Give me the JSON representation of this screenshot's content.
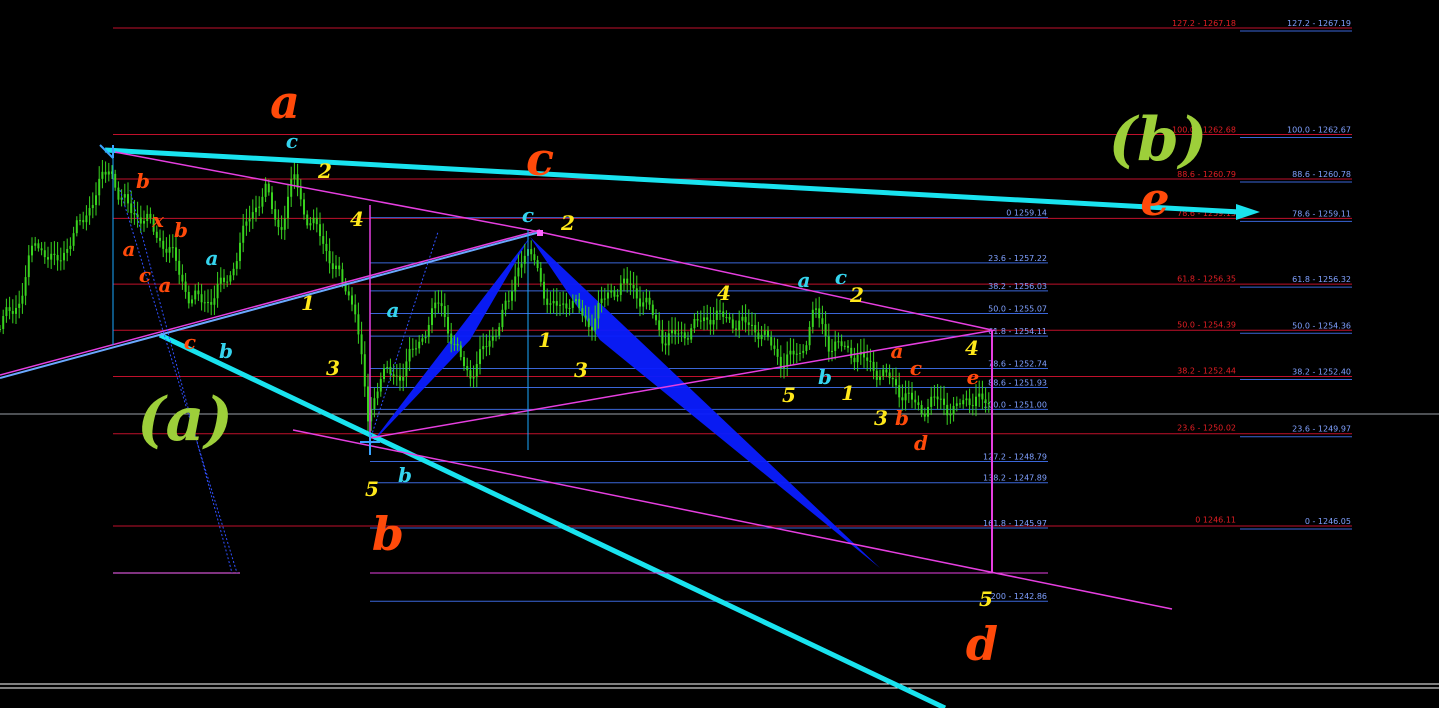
{
  "chart_data": {
    "type": "candlestick",
    "title": "",
    "colors": {
      "background": "#000000",
      "candle": "#39d31f",
      "fib_red_line": "#c0102b",
      "fib_red_text": "#e31e24",
      "fib_blue_line": "#3a66d8",
      "fib_blue_text": "#7fa0ff",
      "trend_cyan": "#19e3ef",
      "channel_magenta": "#e63fe0",
      "pattern_blue": "#0a1cff",
      "wave_orange": "#ff4a0a",
      "wave_yellow": "#ffe81a",
      "wave_cyan": "#35d4ee",
      "wave_green": "#9dcf3a"
    },
    "fib_set_right": [
      {
        "ratio": "127.2",
        "value": 1267.19
      },
      {
        "ratio": "100.0",
        "value": 1262.67
      },
      {
        "ratio": "88.6",
        "value": 1260.78
      },
      {
        "ratio": "78.6",
        "value": 1259.11
      },
      {
        "ratio": "61.8",
        "value": 1256.32
      },
      {
        "ratio": "50.0",
        "value": 1254.36
      },
      {
        "ratio": "38.2",
        "value": 1252.4
      },
      {
        "ratio": "23.6",
        "value": 1249.97
      },
      {
        "ratio": "0",
        "value": 1246.05
      }
    ],
    "fib_set_middle": [
      {
        "ratio": "127.2",
        "value": 1267.18
      },
      {
        "ratio": "100.0",
        "value": 1262.68
      },
      {
        "ratio": "88.6",
        "value": 1260.79
      },
      {
        "ratio": "78.6",
        "value": 1259.13
      },
      {
        "ratio": "61.8",
        "value": 1256.35
      },
      {
        "ratio": "50.0",
        "value": 1254.39
      },
      {
        "ratio": "38.2",
        "value": 1252.44
      },
      {
        "ratio": "23.6",
        "value": 1250.02
      },
      {
        "ratio": "0",
        "value": 1246.11
      }
    ],
    "fib_set_left": [
      {
        "ratio": "0",
        "value": 1259.14
      },
      {
        "ratio": "23.6",
        "value": 1257.22
      },
      {
        "ratio": "38.2",
        "value": 1256.03
      },
      {
        "ratio": "50.0",
        "value": 1255.07
      },
      {
        "ratio": "61.8",
        "value": 1254.11
      },
      {
        "ratio": "78.6",
        "value": 1252.74
      },
      {
        "ratio": "88.6",
        "value": 1251.93
      },
      {
        "ratio": "100.0",
        "value": 1251.0
      },
      {
        "ratio": "127.2",
        "value": 1248.79
      },
      {
        "ratio": "138.2",
        "value": 1247.89
      },
      {
        "ratio": "161.8",
        "value": 1245.97
      },
      {
        "ratio": "200",
        "value": 1242.86
      }
    ],
    "wave_labels": [
      {
        "text": "a",
        "color": "orange",
        "size": "large"
      },
      {
        "text": "c",
        "color": "orange",
        "size": "large"
      },
      {
        "text": "b",
        "color": "orange",
        "size": "large"
      },
      {
        "text": "d",
        "color": "orange",
        "size": "large"
      },
      {
        "text": "e",
        "color": "orange",
        "size": "large"
      },
      {
        "text": "(a)",
        "color": "green",
        "size": "xlarge"
      },
      {
        "text": "(b)",
        "color": "green",
        "size": "xlarge"
      },
      {
        "text": "c",
        "color": "cyan",
        "size": "small"
      },
      {
        "text": "2",
        "color": "yellow",
        "size": "small"
      },
      {
        "text": "4",
        "color": "yellow",
        "size": "small"
      },
      {
        "text": "b",
        "color": "orange",
        "size": "small"
      },
      {
        "text": "x",
        "color": "orange",
        "size": "small"
      },
      {
        "text": "a",
        "color": "orange",
        "size": "small"
      },
      {
        "text": "b",
        "color": "orange",
        "size": "small"
      },
      {
        "text": "c",
        "color": "orange",
        "size": "small"
      },
      {
        "text": "a",
        "color": "orange",
        "size": "small"
      },
      {
        "text": "a",
        "color": "cyan",
        "size": "small"
      },
      {
        "text": "1",
        "color": "yellow",
        "size": "small"
      },
      {
        "text": "c",
        "color": "orange",
        "size": "small"
      },
      {
        "text": "b",
        "color": "cyan",
        "size": "small"
      },
      {
        "text": "3",
        "color": "yellow",
        "size": "small"
      },
      {
        "text": "a",
        "color": "cyan",
        "size": "small"
      },
      {
        "text": "5",
        "color": "yellow",
        "size": "small"
      },
      {
        "text": "b",
        "color": "cyan",
        "size": "small"
      },
      {
        "text": "c",
        "color": "cyan",
        "size": "small"
      },
      {
        "text": "2",
        "color": "yellow",
        "size": "small"
      },
      {
        "text": "1",
        "color": "yellow",
        "size": "small"
      },
      {
        "text": "3",
        "color": "yellow",
        "size": "small"
      },
      {
        "text": "4",
        "color": "yellow",
        "size": "small"
      },
      {
        "text": "a",
        "color": "cyan",
        "size": "small"
      },
      {
        "text": "c",
        "color": "cyan",
        "size": "small"
      },
      {
        "text": "2",
        "color": "yellow",
        "size": "small"
      },
      {
        "text": "5",
        "color": "yellow",
        "size": "small"
      },
      {
        "text": "b",
        "color": "cyan",
        "size": "small"
      },
      {
        "text": "1",
        "color": "yellow",
        "size": "small"
      },
      {
        "text": "a",
        "color": "orange",
        "size": "small"
      },
      {
        "text": "c",
        "color": "orange",
        "size": "small"
      },
      {
        "text": "3",
        "color": "yellow",
        "size": "small"
      },
      {
        "text": "b",
        "color": "orange",
        "size": "small"
      },
      {
        "text": "d",
        "color": "orange",
        "size": "small"
      },
      {
        "text": "4",
        "color": "yellow",
        "size": "small"
      },
      {
        "text": "e",
        "color": "orange",
        "size": "small"
      },
      {
        "text": "5",
        "color": "yellow",
        "size": "small"
      }
    ]
  }
}
